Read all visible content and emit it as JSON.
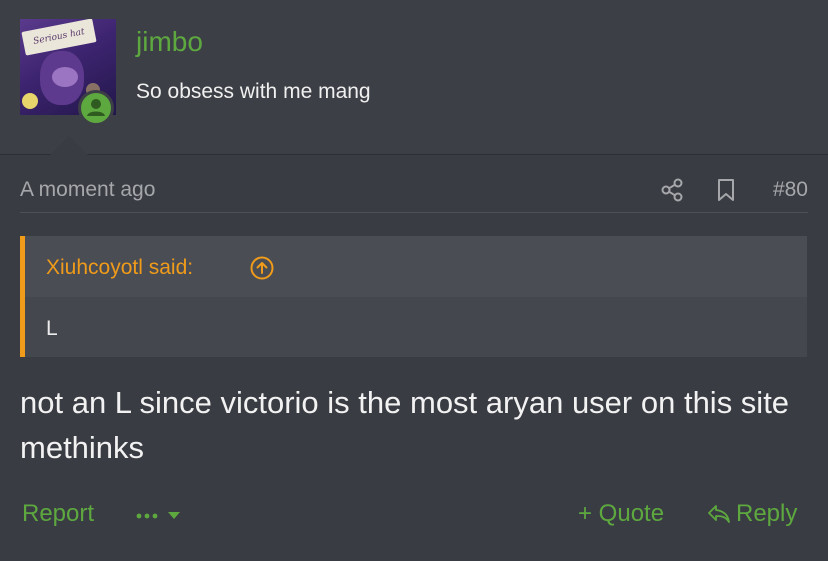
{
  "post": {
    "username": "jimbo",
    "user_title": "So obsess with me mang",
    "avatar_caption": "Serious hat",
    "timestamp": "A moment ago",
    "post_number": "#80",
    "quote": {
      "author": "Xiuhcoyotl said:",
      "text": "L"
    },
    "message": "not an L since victorio is the most aryan user on this site methinks"
  },
  "actions": {
    "report": "Report",
    "quote": "+ Quote",
    "reply": "Reply"
  },
  "colors": {
    "background": "#393c42",
    "username": "#5ea840",
    "quote_accent": "#f09b1a",
    "muted_text": "#a5a7ab"
  },
  "icons": [
    "user-online-icon",
    "share-icon",
    "bookmark-icon",
    "arrow-up-circle-icon",
    "more-dots-icon",
    "chevron-down-icon",
    "reply-arrow-icon"
  ]
}
